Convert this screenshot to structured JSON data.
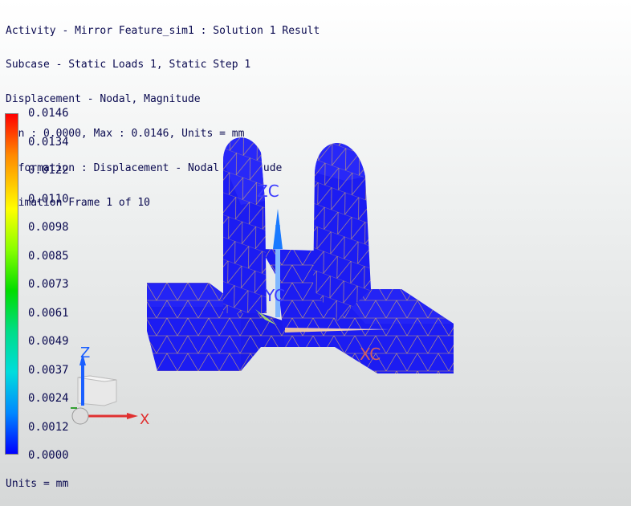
{
  "header": {
    "lines": [
      "Activity - Mirror Feature_sim1 : Solution 1 Result",
      "Subcase - Static Loads 1, Static Step 1",
      "Displacement - Nodal, Magnitude",
      "Min : 0.0000, Max : 0.0146, Units = mm",
      "Deformation : Displacement - Nodal Magnitude",
      "Animation Frame 1 of 10"
    ]
  },
  "legend": {
    "values": [
      "0.0146",
      "0.0134",
      "0.0122",
      "0.0110",
      "0.0098",
      "0.0085",
      "0.0073",
      "0.0061",
      "0.0049",
      "0.0037",
      "0.0024",
      "0.0012",
      "0.0000"
    ],
    "units_label": "Units = mm"
  },
  "triad": {
    "x_label": "X",
    "z_label": "Z"
  },
  "wcs": {
    "xc_label": "XC",
    "yc_label": "YC",
    "zc_label": "ZC"
  },
  "colors": {
    "mesh_fill": "#1c1cf2",
    "mesh_line": "#c8a070",
    "text": "#0a0a50"
  }
}
